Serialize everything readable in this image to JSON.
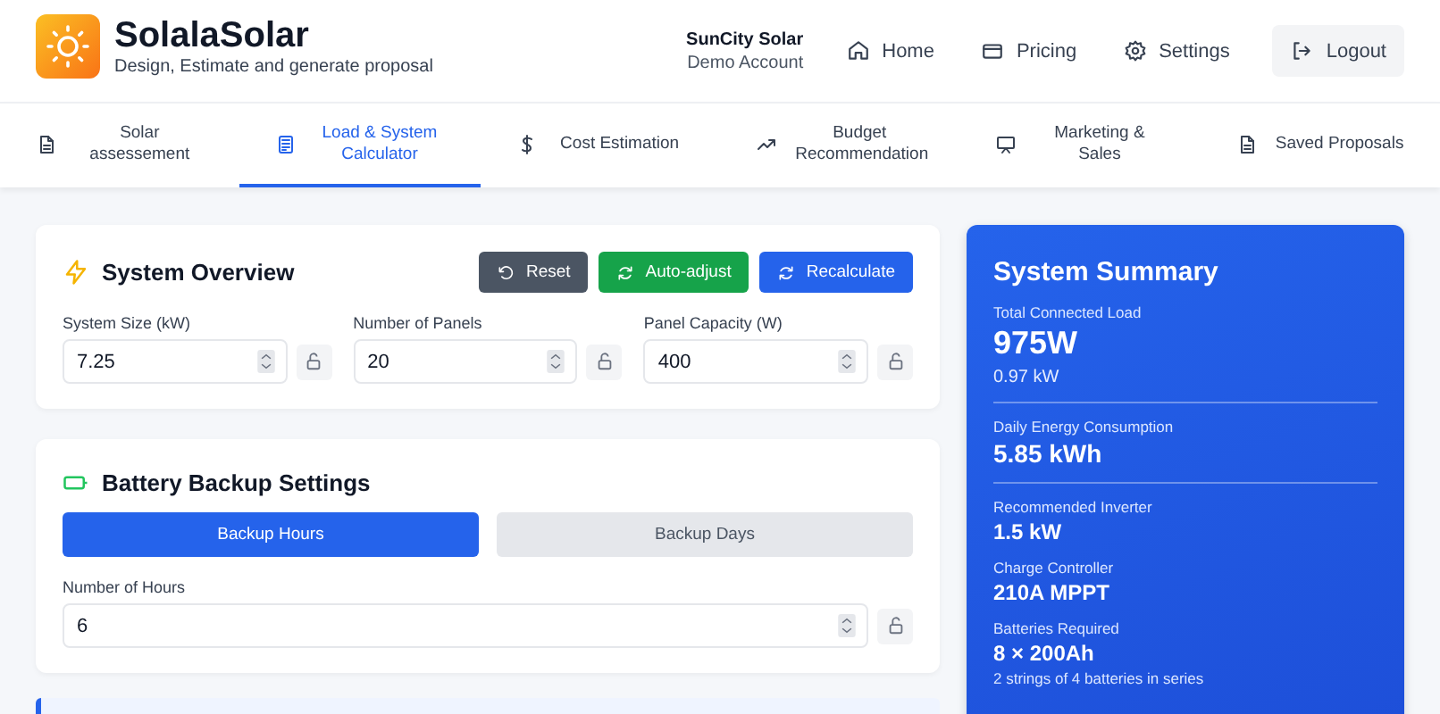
{
  "header": {
    "app_name": "SolalaSolar",
    "tagline": "Design, Estimate and generate proposal",
    "account": {
      "company": "SunCity Solar",
      "role": "Demo Account"
    },
    "nav": [
      {
        "kind": "home",
        "label": "Home"
      },
      {
        "kind": "pricing",
        "label": "Pricing"
      },
      {
        "kind": "settings",
        "label": "Settings"
      },
      {
        "kind": "logout",
        "label": "Logout"
      }
    ]
  },
  "tabs": [
    {
      "kind": "doc",
      "label": "Solar assessement",
      "selected": false
    },
    {
      "kind": "calc",
      "label": "Load & System Calculator",
      "selected": true
    },
    {
      "kind": "dollar",
      "label": "Cost Estimation",
      "selected": false
    },
    {
      "kind": "trend",
      "label": "Budget Recommendation",
      "selected": false
    },
    {
      "kind": "board",
      "label": "Marketing & Sales",
      "selected": false
    },
    {
      "kind": "doc",
      "label": "Saved Proposals",
      "selected": false
    }
  ],
  "system_overview": {
    "title": "System Overview",
    "buttons": [
      {
        "kind": "reset",
        "label": "Reset"
      },
      {
        "kind": "auto",
        "label": "Auto-adjust"
      },
      {
        "kind": "recalc",
        "label": "Recalculate"
      }
    ],
    "fields": [
      {
        "label": "System Size (kW)",
        "value": "7.25",
        "locked": false
      },
      {
        "label": "Number of Panels",
        "value": "20",
        "locked": false
      },
      {
        "label": "Panel Capacity (W)",
        "value": "400",
        "locked": false
      }
    ]
  },
  "battery_backup": {
    "title": "Battery Backup Settings",
    "modes": [
      {
        "label": "Backup Hours",
        "selected": true
      },
      {
        "label": "Backup Days",
        "selected": false
      }
    ],
    "field": {
      "label": "Number of Hours",
      "value": "6",
      "locked": false
    }
  },
  "summary": {
    "title": "System Summary",
    "items": [
      {
        "kind": "headline",
        "label": "Total Connected Load",
        "value": "975W",
        "note": "0.97 kW",
        "divider": true
      },
      {
        "kind": "metric",
        "label": "Daily Energy Consumption",
        "value": "5.85 kWh",
        "divider": true
      },
      {
        "kind": "spec",
        "label": "Recommended Inverter",
        "value": "1.5 kW",
        "divider": false
      },
      {
        "kind": "spec",
        "label": "Charge Controller",
        "value": "210A MPPT",
        "divider": false
      },
      {
        "kind": "spec",
        "label": "Batteries Required",
        "value": "8 × 200Ah",
        "note": "2 strings of 4 batteries in series",
        "divider": false
      }
    ]
  }
}
